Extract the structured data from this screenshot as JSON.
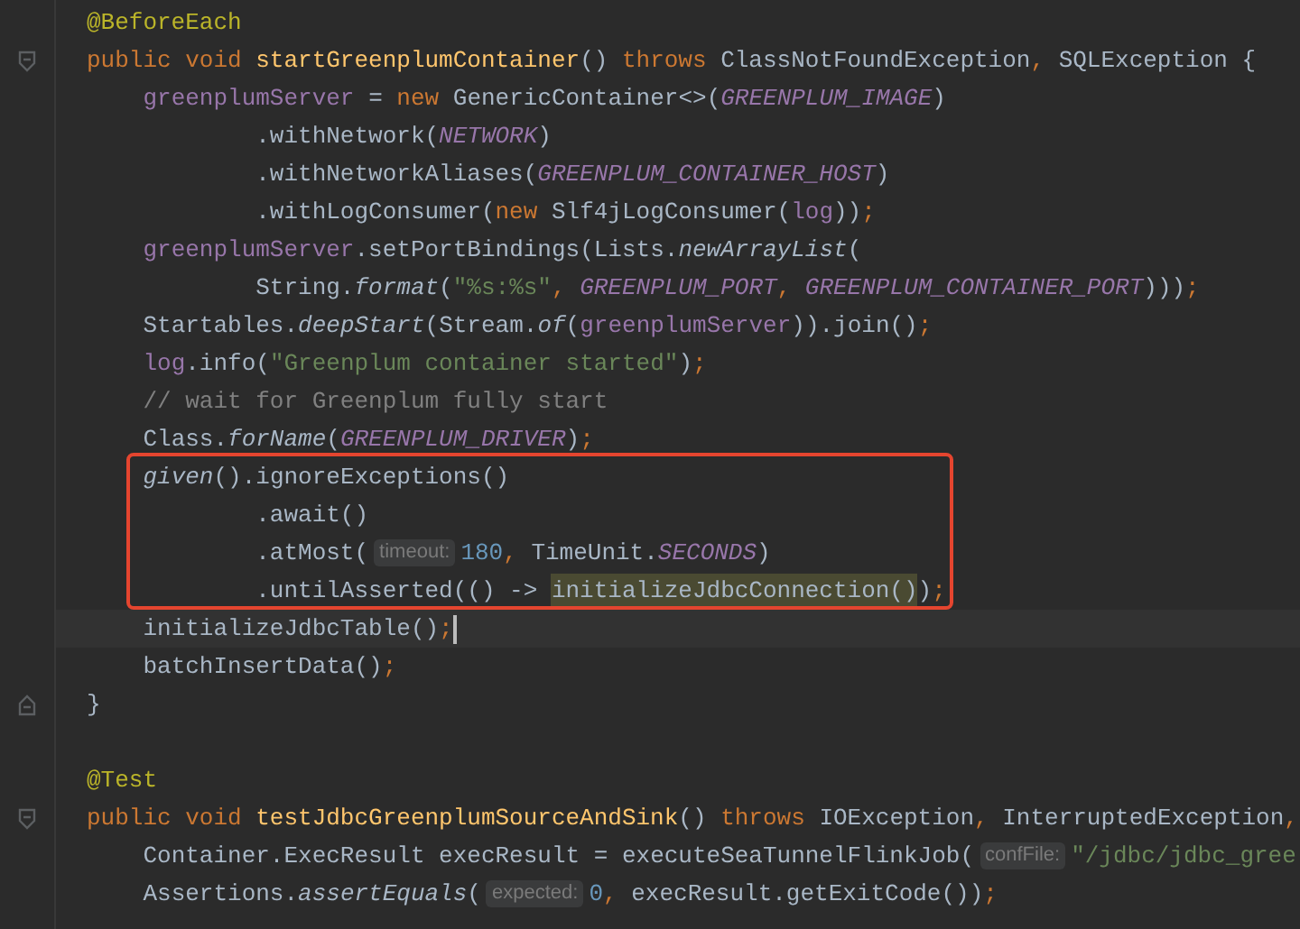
{
  "editor": {
    "sections": [
      {
        "kind": "plain",
        "lines": [
          {
            "fold_start": false,
            "fold_end": false,
            "current": false,
            "tokens": [
              {
                "kind": "annotation",
                "text": "@BeforeEach"
              }
            ]
          },
          {
            "fold_start": true,
            "fold_end": false,
            "current": false,
            "tokens": [
              {
                "kind": "keyword",
                "text": "public void "
              },
              {
                "kind": "declaration",
                "text": "startGreenplumContainer"
              },
              {
                "kind": "plain",
                "text": "() "
              },
              {
                "kind": "keyword",
                "text": "throws "
              },
              {
                "kind": "plain",
                "text": "ClassNotFoundException"
              },
              {
                "kind": "punct",
                "text": ", "
              },
              {
                "kind": "plain",
                "text": "SQLException {"
              }
            ]
          },
          {
            "fold_start": false,
            "fold_end": false,
            "current": false,
            "tokens": [
              {
                "kind": "field",
                "text": "    greenplumServer"
              },
              {
                "kind": "plain",
                "text": " = "
              },
              {
                "kind": "keyword",
                "text": "new "
              },
              {
                "kind": "plain",
                "text": "GenericContainer<>("
              },
              {
                "kind": "constant",
                "text": "GREENPLUM_IMAGE"
              },
              {
                "kind": "plain",
                "text": ")"
              }
            ]
          },
          {
            "fold_start": false,
            "fold_end": false,
            "current": false,
            "tokens": [
              {
                "kind": "plain",
                "text": "            .withNetwork("
              },
              {
                "kind": "constant",
                "text": "NETWORK"
              },
              {
                "kind": "plain",
                "text": ")"
              }
            ]
          },
          {
            "fold_start": false,
            "fold_end": false,
            "current": false,
            "tokens": [
              {
                "kind": "plain",
                "text": "            .withNetworkAliases("
              },
              {
                "kind": "constant",
                "text": "GREENPLUM_CONTAINER_HOST"
              },
              {
                "kind": "plain",
                "text": ")"
              }
            ]
          },
          {
            "fold_start": false,
            "fold_end": false,
            "current": false,
            "tokens": [
              {
                "kind": "plain",
                "text": "            .withLogConsumer("
              },
              {
                "kind": "keyword",
                "text": "new "
              },
              {
                "kind": "plain",
                "text": "Slf4jLogConsumer("
              },
              {
                "kind": "field",
                "text": "log"
              },
              {
                "kind": "plain",
                "text": "))"
              },
              {
                "kind": "punct",
                "text": ";"
              }
            ]
          },
          {
            "fold_start": false,
            "fold_end": false,
            "current": false,
            "tokens": [
              {
                "kind": "field",
                "text": "    greenplumServer"
              },
              {
                "kind": "plain",
                "text": ".setPortBindings(Lists."
              },
              {
                "kind": "static",
                "text": "newArrayList"
              },
              {
                "kind": "plain",
                "text": "("
              }
            ]
          },
          {
            "fold_start": false,
            "fold_end": false,
            "current": false,
            "tokens": [
              {
                "kind": "plain",
                "text": "            String."
              },
              {
                "kind": "static",
                "text": "format"
              },
              {
                "kind": "plain",
                "text": "("
              },
              {
                "kind": "string",
                "text": "\"%s:%s\""
              },
              {
                "kind": "punct",
                "text": ", "
              },
              {
                "kind": "constant",
                "text": "GREENPLUM_PORT"
              },
              {
                "kind": "punct",
                "text": ", "
              },
              {
                "kind": "constant",
                "text": "GREENPLUM_CONTAINER_PORT"
              },
              {
                "kind": "plain",
                "text": ")))"
              },
              {
                "kind": "punct",
                "text": ";"
              }
            ]
          },
          {
            "fold_start": false,
            "fold_end": false,
            "current": false,
            "tokens": [
              {
                "kind": "plain",
                "text": "    Startables."
              },
              {
                "kind": "static",
                "text": "deepStart"
              },
              {
                "kind": "plain",
                "text": "(Stream."
              },
              {
                "kind": "static",
                "text": "of"
              },
              {
                "kind": "plain",
                "text": "("
              },
              {
                "kind": "field",
                "text": "greenplumServer"
              },
              {
                "kind": "plain",
                "text": ")).join()"
              },
              {
                "kind": "punct",
                "text": ";"
              }
            ]
          },
          {
            "fold_start": false,
            "fold_end": false,
            "current": false,
            "tokens": [
              {
                "kind": "field",
                "text": "    log"
              },
              {
                "kind": "plain",
                "text": ".info("
              },
              {
                "kind": "string",
                "text": "\"Greenplum container started\""
              },
              {
                "kind": "plain",
                "text": ")"
              },
              {
                "kind": "punct",
                "text": ";"
              }
            ]
          },
          {
            "fold_start": false,
            "fold_end": false,
            "current": false,
            "tokens": [
              {
                "kind": "comment",
                "text": "    // wait for Greenplum fully start"
              }
            ]
          },
          {
            "fold_start": false,
            "fold_end": false,
            "current": false,
            "tokens": [
              {
                "kind": "plain",
                "text": "    Class."
              },
              {
                "kind": "static",
                "text": "forName"
              },
              {
                "kind": "plain",
                "text": "("
              },
              {
                "kind": "constant",
                "text": "GREENPLUM_DRIVER"
              },
              {
                "kind": "plain",
                "text": ")"
              },
              {
                "kind": "punct",
                "text": ";"
              }
            ]
          }
        ]
      },
      {
        "kind": "boxed",
        "lines": [
          {
            "fold_start": false,
            "fold_end": false,
            "current": false,
            "tokens": [
              {
                "kind": "static",
                "text": "    given"
              },
              {
                "kind": "plain",
                "text": "().ignoreExceptions()"
              }
            ]
          },
          {
            "fold_start": false,
            "fold_end": false,
            "current": false,
            "tokens": [
              {
                "kind": "plain",
                "text": "            .await()"
              }
            ]
          },
          {
            "fold_start": false,
            "fold_end": false,
            "current": false,
            "tokens": [
              {
                "kind": "plain",
                "text": "            .atMost("
              },
              {
                "kind": "hint",
                "text": "timeout:"
              },
              {
                "kind": "number",
                "text": "180"
              },
              {
                "kind": "punct",
                "text": ", "
              },
              {
                "kind": "plain",
                "text": "TimeUnit."
              },
              {
                "kind": "constant",
                "text": "SECONDS"
              },
              {
                "kind": "plain",
                "text": ")"
              }
            ]
          },
          {
            "fold_start": false,
            "fold_end": false,
            "current": false,
            "tokens": [
              {
                "kind": "plain",
                "text": "            .untilAsserted(() -> "
              },
              {
                "kind": "usage",
                "text": "initializeJdbcConnection()"
              },
              {
                "kind": "plain",
                "text": ")"
              },
              {
                "kind": "punct",
                "text": ";"
              }
            ]
          }
        ]
      },
      {
        "kind": "plain",
        "lines": [
          {
            "fold_start": false,
            "fold_end": false,
            "current": true,
            "tokens": [
              {
                "kind": "plain",
                "text": "    initializeJdbcTable()"
              },
              {
                "kind": "punct",
                "text": ";"
              }
            ]
          },
          {
            "fold_start": false,
            "fold_end": false,
            "current": false,
            "tokens": [
              {
                "kind": "plain",
                "text": "    batchInsertData()"
              },
              {
                "kind": "punct",
                "text": ";"
              }
            ]
          },
          {
            "fold_start": false,
            "fold_end": true,
            "current": false,
            "tokens": [
              {
                "kind": "plain",
                "text": "}"
              }
            ]
          },
          {
            "fold_start": false,
            "fold_end": false,
            "current": false
          },
          {
            "fold_start": false,
            "fold_end": false,
            "current": false,
            "tokens": [
              {
                "kind": "annotation",
                "text": "@Test"
              }
            ]
          },
          {
            "fold_start": true,
            "fold_end": false,
            "current": false,
            "tokens": [
              {
                "kind": "keyword",
                "text": "public void "
              },
              {
                "kind": "declaration",
                "text": "testJdbcGreenplumSourceAndSink"
              },
              {
                "kind": "plain",
                "text": "() "
              },
              {
                "kind": "keyword",
                "text": "throws "
              },
              {
                "kind": "plain",
                "text": "IOException"
              },
              {
                "kind": "punct",
                "text": ", "
              },
              {
                "kind": "plain",
                "text": "InterruptedException"
              },
              {
                "kind": "punct",
                "text": ","
              }
            ]
          },
          {
            "fold_start": false,
            "fold_end": false,
            "current": false,
            "tokens": [
              {
                "kind": "plain",
                "text": "    Container.ExecResult execResult = executeSeaTunnelFlinkJob("
              },
              {
                "kind": "hint",
                "text": "confFile:"
              },
              {
                "kind": "string",
                "text": "\"/jdbc/jdbc_gree"
              }
            ]
          },
          {
            "fold_start": false,
            "fold_end": false,
            "current": false,
            "tokens": [
              {
                "kind": "plain",
                "text": "    Assertions."
              },
              {
                "kind": "static",
                "text": "assertEquals"
              },
              {
                "kind": "plain",
                "text": "("
              },
              {
                "kind": "hint",
                "text": "expected:"
              },
              {
                "kind": "number",
                "text": "0"
              },
              {
                "kind": "punct",
                "text": ", "
              },
              {
                "kind": "plain",
                "text": "execResult.getExitCode())"
              },
              {
                "kind": "punct",
                "text": ";"
              }
            ]
          }
        ]
      }
    ]
  }
}
